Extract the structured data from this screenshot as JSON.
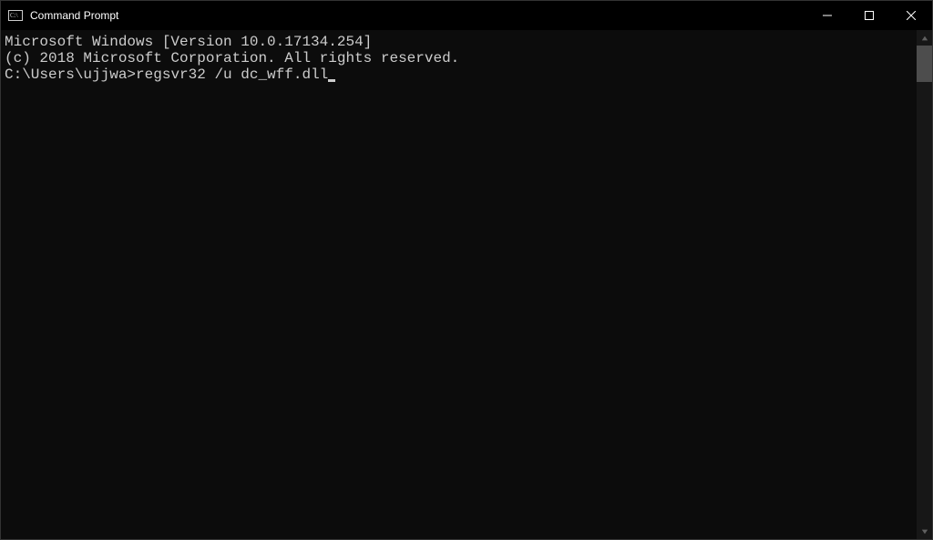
{
  "titlebar": {
    "title": "Command Prompt"
  },
  "terminal": {
    "line1": "Microsoft Windows [Version 10.0.17134.254]",
    "line2": "(c) 2018 Microsoft Corporation. All rights reserved.",
    "blank": "",
    "prompt": "C:\\Users\\ujjwa>",
    "command": "regsvr32 /u dc_wff.dll"
  }
}
